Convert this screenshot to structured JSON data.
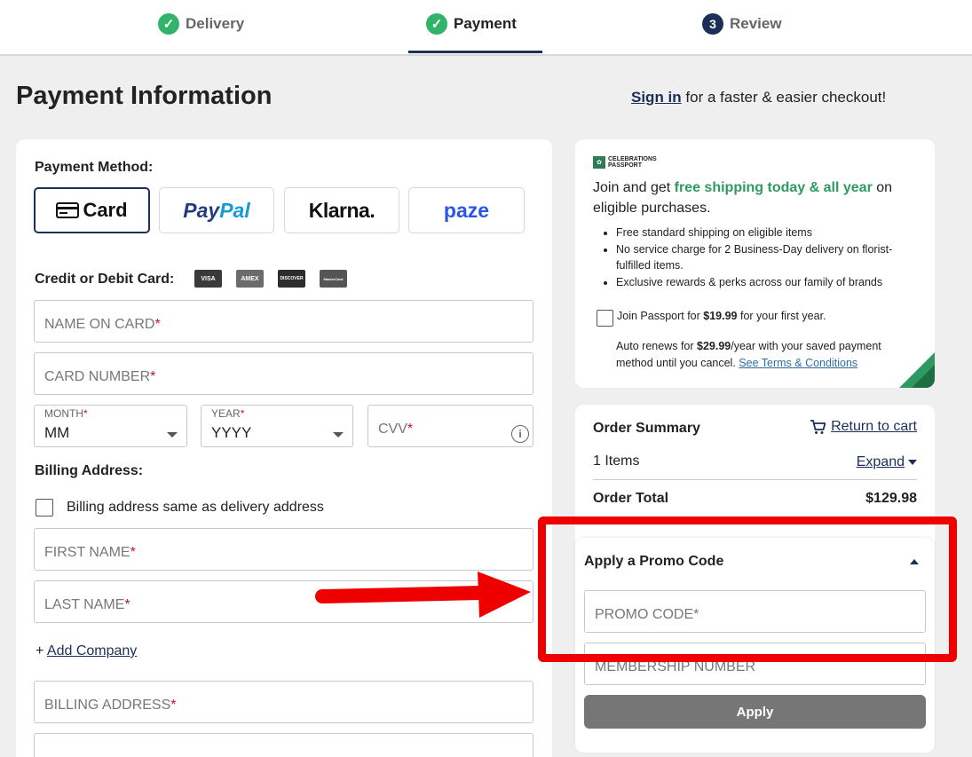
{
  "steps": [
    {
      "label": "Delivery",
      "state": "done",
      "marker": "✓"
    },
    {
      "label": "Payment",
      "state": "current",
      "marker": "✓"
    },
    {
      "label": "Review",
      "state": "pending",
      "marker": "3"
    }
  ],
  "header": {
    "title": "Payment Information",
    "signin_link": "Sign in",
    "signin_rest": " for a faster & easier checkout!"
  },
  "payment": {
    "method_label": "Payment Method:",
    "methods": [
      {
        "label": "Card",
        "selected": true
      },
      {
        "label_a": "Pay",
        "label_b": "Pal",
        "selected": false
      },
      {
        "label": "Klarna.",
        "selected": false
      },
      {
        "label": "paze",
        "selected": false
      }
    ],
    "cc_label": "Credit or Debit Card:",
    "cc_logos": [
      "VISA",
      "AMEX",
      "DISCOVER",
      "MasterCard"
    ],
    "fields": {
      "name_on_card": "NAME ON CARD",
      "card_number": "CARD NUMBER",
      "month_label": "MONTH",
      "month_value": "MM",
      "year_label": "YEAR",
      "year_value": "YYYY",
      "cvv": "CVV",
      "required_mark": "*"
    },
    "billing": {
      "label": "Billing Address:",
      "same_as_delivery": "Billing address same as delivery address",
      "first_name": "FIRST NAME",
      "last_name": "LAST NAME",
      "add_company_prefix": "+ ",
      "add_company": "Add Company",
      "billing_address": "BILLING ADDRESS"
    }
  },
  "passport": {
    "logo_line1": "CELEBRATIONS",
    "logo_line2": "PASSPORT",
    "headline_a": "Join and get ",
    "headline_green": "free shipping today & all year",
    "headline_b": " on eligible purchases.",
    "benefits": [
      "Free standard shipping on eligible items",
      "No service charge for 2 Business-Day delivery on florist-fulfilled items.",
      "Exclusive rewards & perks across our family of brands"
    ],
    "join_a": "Join Passport for ",
    "join_price": "$19.99",
    "join_b": " for your first year.",
    "renew_a": "Auto renews for ",
    "renew_price": "$29.99",
    "renew_b": "/year with your saved payment method until you cancel. ",
    "terms_link": "See Terms & Conditions",
    "accent_color": "#2e9a61"
  },
  "summary": {
    "title": "Order Summary",
    "return_link": "Return to cart",
    "items": "1 Items",
    "expand": "Expand",
    "total_label": "Order Total",
    "total_value": "$129.98"
  },
  "promo": {
    "title": "Apply a Promo Code",
    "promo_code": "PROMO CODE",
    "membership": "MEMBERSHIP NUMBER",
    "apply": "Apply"
  },
  "annotation": {
    "color": "#ef0000"
  }
}
